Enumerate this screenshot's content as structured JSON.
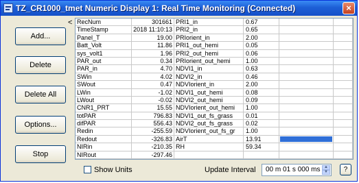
{
  "window": {
    "title": "TZ_CR1000_tmet Numeric Display 1: Real Time Monitoring (Connected)"
  },
  "buttons": {
    "add": "Add...",
    "delete": "Delete",
    "delete_all": "Delete All",
    "options": "Options...",
    "stop": "Stop"
  },
  "collapse_arrow": "<",
  "left_rows": [
    {
      "name": "RecNum",
      "value": "301661"
    },
    {
      "name": "TimeStamp",
      "value": "2018 11:10:13"
    },
    {
      "name": "Panel_T",
      "value": "19.00"
    },
    {
      "name": "Batt_Volt",
      "value": "11.86"
    },
    {
      "name": "sys_volt1",
      "value": "1.96"
    },
    {
      "name": "PAR_out",
      "value": "0.34"
    },
    {
      "name": "PAR_in",
      "value": "4.70"
    },
    {
      "name": "SWin",
      "value": "4.02"
    },
    {
      "name": "SWout",
      "value": "0.47"
    },
    {
      "name": "LWin",
      "value": "-1.02"
    },
    {
      "name": "LWout",
      "value": "-0.02"
    },
    {
      "name": "CNR1_PRT",
      "value": "15.55"
    },
    {
      "name": "totPAR",
      "value": "796.83"
    },
    {
      "name": "difPAR",
      "value": "556.43"
    },
    {
      "name": "Redin",
      "value": "-255.59"
    },
    {
      "name": "Redout",
      "value": "-326.83"
    },
    {
      "name": "NIRin",
      "value": "-210.35"
    },
    {
      "name": "NIRout",
      "value": "-297.46"
    }
  ],
  "right_rows": [
    {
      "name": "PRI1_in",
      "value": "0.67"
    },
    {
      "name": "PRI2_in",
      "value": "0.65"
    },
    {
      "name": "PRIorient_in",
      "value": "2.00"
    },
    {
      "name": "PRI1_out_hemi",
      "value": "0.05"
    },
    {
      "name": "PRI2_out_hemi",
      "value": "0.06"
    },
    {
      "name": "PRIorient_out_hemi",
      "value": "1.00"
    },
    {
      "name": "NDVI1_in",
      "value": "0.63"
    },
    {
      "name": "NDVI2_in",
      "value": "0.46"
    },
    {
      "name": "NDVIorient_in",
      "value": "2.00"
    },
    {
      "name": "NDVI1_out_hemi",
      "value": "0.08"
    },
    {
      "name": "NDVI2_out_hemi",
      "value": "0.09"
    },
    {
      "name": "NDVIorient_out_hemi",
      "value": "1.00"
    },
    {
      "name": "NDVI1_out_fs_grass",
      "value": "0.01"
    },
    {
      "name": "NDVI2_out_fs_grass",
      "value": "0.02"
    },
    {
      "name": "NDVIorient_out_fs_gr",
      "value": "1.00"
    },
    {
      "name": "AirT",
      "value": "13.91",
      "bar": true
    },
    {
      "name": "RH",
      "value": "59.34"
    },
    {
      "name": "",
      "value": ""
    }
  ],
  "show_units_label": "Show Units",
  "update_interval": {
    "label": "Update Interval",
    "value": "00 m 01 s 000 ms"
  },
  "help_label": "?",
  "close_label": "×",
  "accent_color": "#2f6fd8"
}
